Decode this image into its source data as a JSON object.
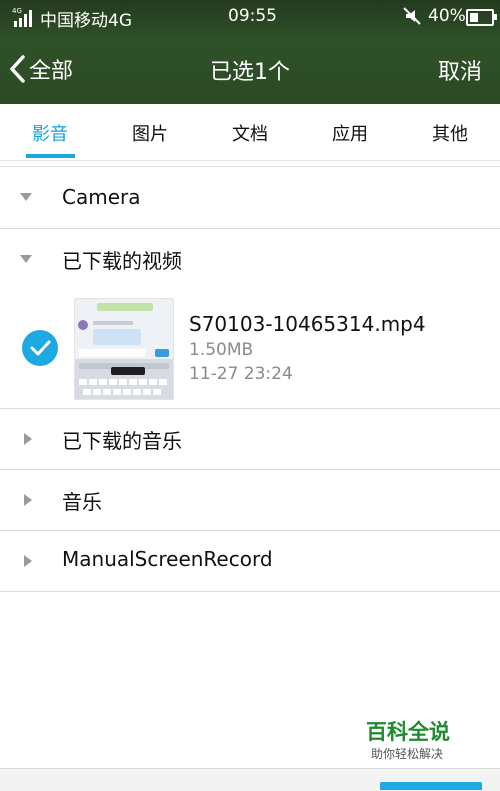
{
  "status_bar": {
    "network_badge": "4G",
    "carrier": "中国移动4G",
    "time": "09:55",
    "battery": "40%",
    "icons": [
      "signal-icon",
      "mute-icon",
      "battery-icon"
    ]
  },
  "title_bar": {
    "back_label": "全部",
    "title": "已选1个",
    "cancel_label": "取消"
  },
  "tabs": [
    {
      "label": "影音",
      "active": true
    },
    {
      "label": "图片",
      "active": false
    },
    {
      "label": "文档",
      "active": false
    },
    {
      "label": "应用",
      "active": false
    },
    {
      "label": "其他",
      "active": false
    }
  ],
  "folders": [
    {
      "label": "Camera",
      "expanded": true
    },
    {
      "label": "已下载的视频",
      "expanded": true
    },
    {
      "label": "已下载的音乐",
      "expanded": false
    },
    {
      "label": "音乐",
      "expanded": false
    },
    {
      "label": "ManualScreenRecord",
      "expanded": false
    }
  ],
  "file": {
    "name": "S70103-10465314.mp4",
    "size": "1.50MB",
    "date": "11-27 23:24",
    "selected": true
  },
  "watermark": {
    "title": "百科全说",
    "subtitle": "助你轻松解决"
  },
  "colors": {
    "header": "#2b4a24",
    "accent": "#1fa9e3",
    "watermark": "#1f8b2d"
  }
}
